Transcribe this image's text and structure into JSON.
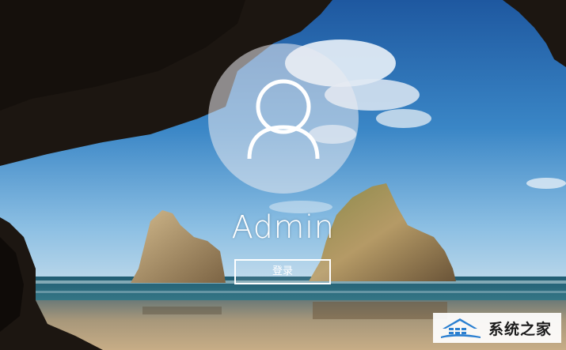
{
  "login": {
    "username": "Admin",
    "signin_label": "登录"
  },
  "avatar": {
    "icon": "user-silhouette-icon"
  },
  "watermark": {
    "text": "系统之家",
    "logo_icon": "house-logo-icon"
  },
  "colors": {
    "avatar_circle": "#e6e6ec",
    "text": "#ffffff",
    "sky_top": "#1f5fa8",
    "sky_bottom": "#9cc7e6",
    "sea": "#245e74",
    "sand": "#b9a27e",
    "rock": "#1a140f"
  }
}
